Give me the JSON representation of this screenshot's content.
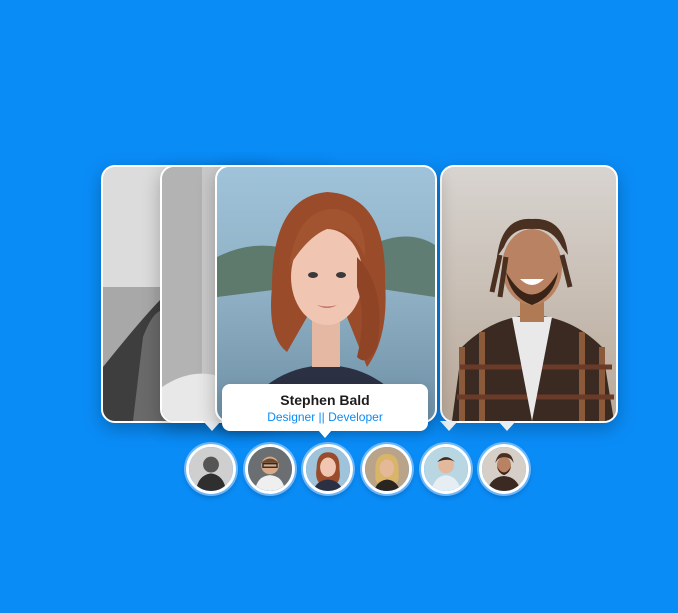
{
  "featured": {
    "name": "Stephen Bald",
    "role": "Designer || Developer"
  },
  "colors": {
    "background": "#0a8cf7",
    "accent": "#0a8cf7",
    "card_border": "#ffffff"
  },
  "cards": [
    {
      "id": "card-1",
      "tone": "black-and-white",
      "depicts": "profile-photo"
    },
    {
      "id": "card-2",
      "tone": "grayscale",
      "depicts": "profile-photo"
    },
    {
      "id": "card-3",
      "tone": "color",
      "depicts": "profile-photo",
      "active": true
    },
    {
      "id": "card-6",
      "tone": "color",
      "depicts": "profile-photo"
    }
  ],
  "thumbnails": [
    {
      "id": "thumb-1",
      "depicts": "avatar-photo"
    },
    {
      "id": "thumb-2",
      "depicts": "avatar-photo"
    },
    {
      "id": "thumb-3",
      "depicts": "avatar-photo",
      "active": true
    },
    {
      "id": "thumb-4",
      "depicts": "avatar-photo"
    },
    {
      "id": "thumb-5",
      "depicts": "avatar-photo"
    },
    {
      "id": "thumb-6",
      "depicts": "avatar-photo"
    }
  ]
}
